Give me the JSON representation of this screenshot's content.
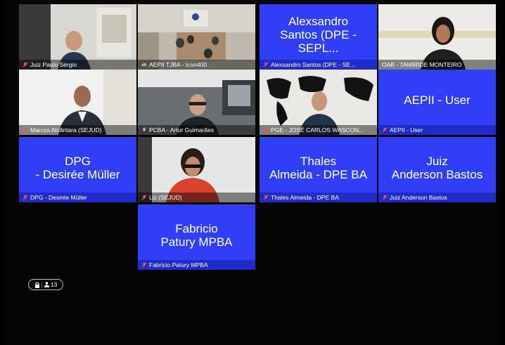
{
  "tiles": [
    {
      "id": "t1",
      "label": "Juiz Paulo Sérgio",
      "muted": true,
      "video": true
    },
    {
      "id": "t2",
      "label": "AEPII TJBA - Icon400",
      "muted": false,
      "video": true,
      "speaking": true
    },
    {
      "id": "t3",
      "label": "Alexsandro Santos (DPE - SE...",
      "big_name": "Alexsandro\nSantos (DPE - SEPL...",
      "muted": true,
      "video": false
    },
    {
      "id": "t4",
      "label": "OAB - TAMIRIDE MONTEIRO",
      "muted": false,
      "video": true
    },
    {
      "id": "t5",
      "label": "Marcos Alcântara (SEJUD)",
      "muted": true,
      "video": true
    },
    {
      "id": "t6",
      "label": "PCBA - Artur Guimarães",
      "muted": false,
      "video": true
    },
    {
      "id": "t7",
      "label": "PGE - JOSÉ CARLOS WASCON...",
      "muted": true,
      "video": true
    },
    {
      "id": "t8",
      "label": "AEPII - User",
      "big_name": "AEPII - User",
      "muted": true,
      "video": false
    },
    {
      "id": "t9",
      "label": "DPG - Desirée Müller",
      "big_name": "DPG\n- Desirée Müller",
      "muted": true,
      "video": false
    },
    {
      "id": "t10",
      "label": "Liz (SEJUD)",
      "muted": true,
      "video": true
    },
    {
      "id": "t11",
      "label": "Thales Almeida - DPE BA",
      "big_name": "Thales\nAlmeida - DPE BA",
      "muted": true,
      "video": false
    },
    {
      "id": "t12",
      "label": "Juiz Anderson Bastos",
      "big_name": "Juiz\nAnderson Bastos",
      "muted": true,
      "video": false
    },
    {
      "id": "t13",
      "label": "Fabricio Patury MPBA",
      "big_name": "Fabricio\nPatury MPBA",
      "muted": true,
      "video": false
    }
  ],
  "participants_badge": {
    "count": "13",
    "icons": [
      "lock-icon",
      "person-icon"
    ]
  },
  "colors": {
    "tile_blue": "#2f3ff6",
    "speaking_border": "#f0c419",
    "mic_muted": "#ff4d4d",
    "background": "#050505"
  }
}
